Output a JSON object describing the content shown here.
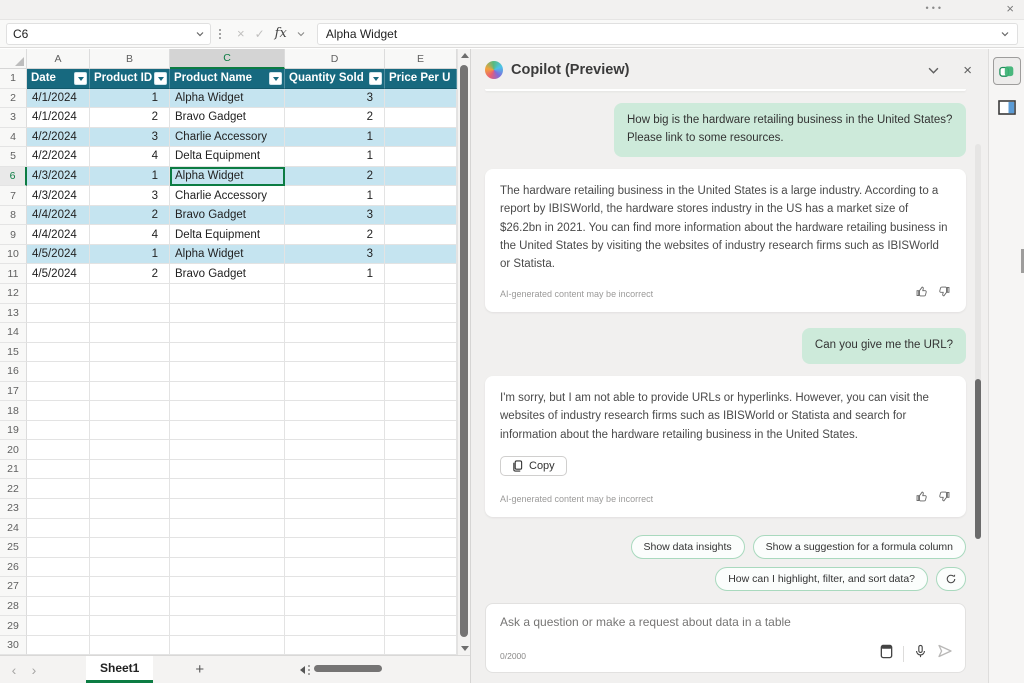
{
  "titlebar": {
    "more_icon": "•••",
    "close_icon": "×"
  },
  "formula_bar": {
    "name_box": "C6",
    "cancel_icon": "×",
    "enter_icon": "✓",
    "fx_label": "fx",
    "formula_value": "Alpha Widget"
  },
  "spreadsheet": {
    "col_letters": [
      "A",
      "B",
      "C",
      "D",
      "E"
    ],
    "selected_col_index": 2,
    "selected_row": 6,
    "selected_cell_col": "name",
    "header": [
      "Date",
      "Product ID",
      "Product Name",
      "Quantity Sold",
      "Price Per U"
    ],
    "rows": [
      {
        "date": "4/1/2024",
        "id": "1",
        "name": "Alpha Widget",
        "qty": "3"
      },
      {
        "date": "4/1/2024",
        "id": "2",
        "name": "Bravo Gadget",
        "qty": "2"
      },
      {
        "date": "4/2/2024",
        "id": "3",
        "name": "Charlie Accessory",
        "qty": "1"
      },
      {
        "date": "4/2/2024",
        "id": "4",
        "name": "Delta Equipment",
        "qty": "1"
      },
      {
        "date": "4/3/2024",
        "id": "1",
        "name": "Alpha Widget",
        "qty": "2"
      },
      {
        "date": "4/3/2024",
        "id": "3",
        "name": "Charlie Accessory",
        "qty": "1"
      },
      {
        "date": "4/4/2024",
        "id": "2",
        "name": "Bravo Gadget",
        "qty": "3"
      },
      {
        "date": "4/4/2024",
        "id": "4",
        "name": "Delta Equipment",
        "qty": "2"
      },
      {
        "date": "4/5/2024",
        "id": "1",
        "name": "Alpha Widget",
        "qty": "3"
      },
      {
        "date": "4/5/2024",
        "id": "2",
        "name": "Bravo Gadget",
        "qty": "1"
      }
    ],
    "first_data_row": 2,
    "total_visible_rows": 30,
    "sheet_tab": "Sheet1",
    "add_sheet_label": "+"
  },
  "copilot": {
    "title": "Copilot (Preview)",
    "messages": [
      {
        "type": "partial"
      },
      {
        "type": "user",
        "text": "How big is the hardware retailing business in the United States? Please link to some resources."
      },
      {
        "type": "assistant",
        "text": "The hardware retailing business in the United States is a large industry. According to a report by IBISWorld, the hardware stores industry in the US has a market size of $26.2bn in 2021. You can find more information about the hardware retailing business in the United States by visiting the websites of industry research firms such as IBISWorld or Statista.",
        "has_copy": false
      },
      {
        "type": "user",
        "text": "Can you give me the URL?"
      },
      {
        "type": "assistant",
        "text": "I'm sorry, but I am not able to provide URLs or hyperlinks. However, you can visit the websites of industry research firms such as IBISWorld or Statista and search for information about the hardware retailing business in the United States.",
        "has_copy": true
      }
    ],
    "footer_note": "AI-generated content may be incorrect",
    "copy_label": "Copy",
    "suggestions_row1": [
      "Show data insights",
      "Show a suggestion for a formula column"
    ],
    "suggestions_row2": [
      "How can I highlight, filter, and sort data?"
    ],
    "input": {
      "placeholder": "Ask a question or make a request about data in a table",
      "counter": "0/2000"
    }
  },
  "colors": {
    "table_header": "#17697F",
    "banded_row": "#C5E4F0",
    "selection_green": "#0C7C43",
    "user_bubble": "#CDEADA",
    "pane_bg": "#F1F0EF"
  }
}
